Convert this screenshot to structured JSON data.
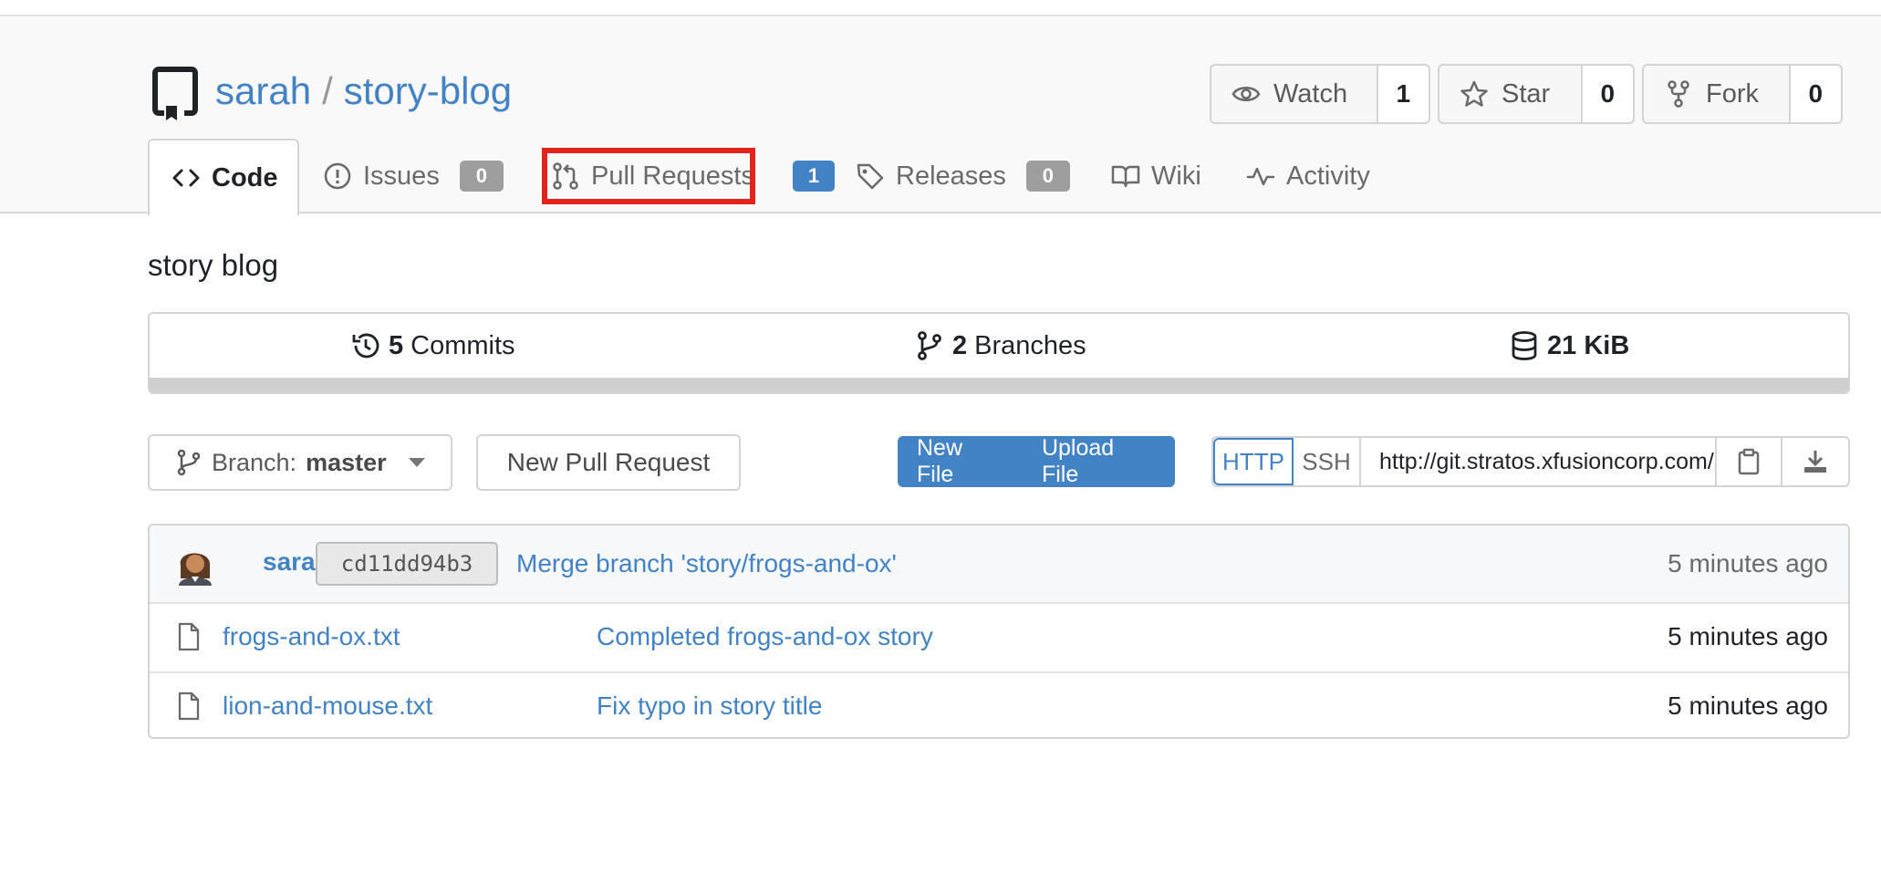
{
  "repo": {
    "owner": "sarah",
    "separator": "/",
    "name": "story-blog",
    "description": "story blog"
  },
  "actions": {
    "watch": {
      "label": "Watch",
      "count": "1"
    },
    "star": {
      "label": "Star",
      "count": "0"
    },
    "fork": {
      "label": "Fork",
      "count": "0"
    }
  },
  "tabs": {
    "code": {
      "label": "Code"
    },
    "issues": {
      "label": "Issues",
      "badge": "0"
    },
    "pulls": {
      "label": "Pull Requests",
      "badge": "1"
    },
    "releases": {
      "label": "Releases",
      "badge": "0"
    },
    "wiki": {
      "label": "Wiki"
    },
    "activity": {
      "label": "Activity"
    }
  },
  "stats": {
    "commits": {
      "count": "5",
      "label": "Commits"
    },
    "branches": {
      "count": "2",
      "label": "Branches"
    },
    "size": {
      "value": "21 KiB"
    }
  },
  "toolbar": {
    "branch_prefix": "Branch:",
    "branch_name": "master",
    "new_pr": "New Pull Request",
    "new_file": "New File",
    "upload_file": "Upload File",
    "http": "HTTP",
    "ssh": "SSH",
    "clone_url": "http://git.stratos.xfusioncorp.com/sarah/story-blog.git"
  },
  "latest_commit": {
    "author": "sarah",
    "sha": "cd11dd94b3",
    "message": "Merge branch 'story/frogs-and-ox'",
    "time": "5 minutes ago"
  },
  "files": [
    {
      "name": "frogs-and-ox.txt",
      "message": "Completed frogs-and-ox story",
      "time": "5 minutes ago"
    },
    {
      "name": "lion-and-mouse.txt",
      "message": "Fix typo in story title",
      "time": "5 minutes ago"
    }
  ],
  "colors": {
    "link": "#4183c4",
    "highlight": "#e3241c",
    "badge": "#9e9e9e"
  }
}
